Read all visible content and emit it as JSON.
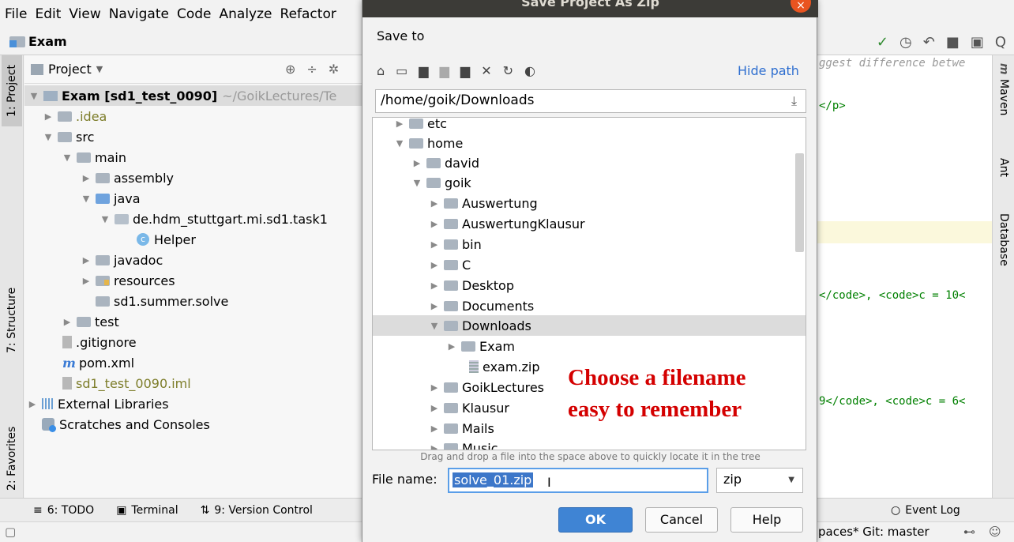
{
  "menu": [
    "File",
    "Edit",
    "View",
    "Navigate",
    "Code",
    "Analyze",
    "Refactor"
  ],
  "nav": {
    "crumb": "Exam"
  },
  "toolbar_right": [
    "✓",
    "◷",
    "↶",
    "■",
    "▣",
    "Q"
  ],
  "left_stripe": {
    "project": "1: Project",
    "structure": "7: Structure",
    "favorites": "2: Favorites"
  },
  "project_panel": {
    "header": "Project",
    "rows": [
      {
        "label": "Exam [sd1_test_0090]",
        "suffix": "~/GoikLectures/Te"
      },
      {
        "label": ".idea"
      },
      {
        "label": "src"
      },
      {
        "label": "main"
      },
      {
        "label": "assembly"
      },
      {
        "label": "java"
      },
      {
        "label": "de.hdm_stuttgart.mi.sd1.task1"
      },
      {
        "label": "Helper"
      },
      {
        "label": "javadoc"
      },
      {
        "label": "resources"
      },
      {
        "label": "sd1.summer.solve"
      },
      {
        "label": "test"
      },
      {
        "label": ".gitignore"
      },
      {
        "label": "pom.xml"
      },
      {
        "label": "sd1_test_0090.iml"
      },
      {
        "label": "External Libraries"
      },
      {
        "label": "Scratches and Consoles"
      }
    ]
  },
  "right_stripe": {
    "maven": "Maven",
    "ant": "Ant",
    "database": "Database",
    "m": "m"
  },
  "editor": {
    "line1": "ggest difference betwe",
    "line2": "</p>",
    "line3a": "</code>, ",
    "line3b": "<code>c = 10<",
    "line4a": "9</code>, ",
    "line4b": "<code>c = 6<"
  },
  "bottom": {
    "todo": "6: TODO",
    "terminal": "Terminal",
    "vcs": "9: Version Control",
    "eventlog": "Event Log"
  },
  "status": {
    "right": "paces*  Git: master"
  },
  "dialog": {
    "title": "Save Project As Zip",
    "save_to": "Save to",
    "hide_path": "Hide path",
    "path": "/home/goik/Downloads",
    "tree": [
      {
        "label": "etc",
        "depth": 1
      },
      {
        "label": "home",
        "depth": 1
      },
      {
        "label": "david",
        "depth": 2
      },
      {
        "label": "goik",
        "depth": 2
      },
      {
        "label": "Auswertung",
        "depth": 3
      },
      {
        "label": "AuswertungKlausur",
        "depth": 3
      },
      {
        "label": "bin",
        "depth": 3
      },
      {
        "label": "C",
        "depth": 3
      },
      {
        "label": "Desktop",
        "depth": 3
      },
      {
        "label": "Documents",
        "depth": 3
      },
      {
        "label": "Downloads",
        "depth": 3
      },
      {
        "label": "Exam",
        "depth": 4
      },
      {
        "label": "exam.zip",
        "depth": 4
      },
      {
        "label": "GoikLectures",
        "depth": 3
      },
      {
        "label": "Klausur",
        "depth": 3
      },
      {
        "label": "Mails",
        "depth": 3
      },
      {
        "label": "Music",
        "depth": 3
      }
    ],
    "drop_hint": "Drag and drop a file into the space above to quickly locate it in the tree",
    "file_name_label": "File name:",
    "file_name_value": "solve_01.zip",
    "extension": "zip",
    "ok": "OK",
    "cancel": "Cancel",
    "help": "Help"
  },
  "annotation": {
    "line1": "Choose a filename",
    "line2": "easy to remember"
  }
}
